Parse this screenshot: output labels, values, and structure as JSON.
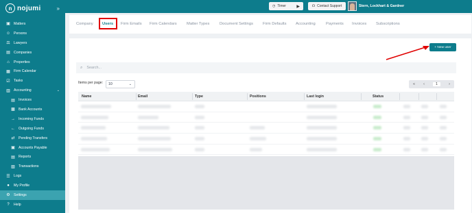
{
  "app": {
    "logo_text": "nojumi",
    "logo_mark": "n"
  },
  "sidebar": {
    "items": [
      {
        "label": "Matters",
        "icon": "briefcase-icon",
        "glyph": "▣"
      },
      {
        "label": "Persons",
        "icon": "persons-icon",
        "glyph": "☺"
      },
      {
        "label": "Lawyers",
        "icon": "lawyer-icon",
        "glyph": "⚖"
      },
      {
        "label": "Companies",
        "icon": "building-icon",
        "glyph": "▤"
      },
      {
        "label": "Properties",
        "icon": "home-icon",
        "glyph": "⌂"
      },
      {
        "label": "Firm Calendar",
        "icon": "calendar-icon",
        "glyph": "▦"
      },
      {
        "label": "Tasks",
        "icon": "tasks-icon",
        "glyph": "☑"
      },
      {
        "label": "Accounting",
        "icon": "wallet-icon",
        "glyph": "▥"
      },
      {
        "label": "Invoices",
        "icon": "invoice-icon",
        "glyph": "▤"
      },
      {
        "label": "Bank Accounts",
        "icon": "bank-icon",
        "glyph": "▩"
      },
      {
        "label": "Incoming Funds",
        "icon": "arrow-right-icon",
        "glyph": "→"
      },
      {
        "label": "Outgoing Funds",
        "icon": "arrow-left-icon",
        "glyph": "←"
      },
      {
        "label": "Pending Transfers",
        "icon": "transfer-icon",
        "glyph": "⇄"
      },
      {
        "label": "Accounts Payable",
        "icon": "payable-icon",
        "glyph": "▣"
      },
      {
        "label": "Reports",
        "icon": "report-icon",
        "glyph": "▤"
      },
      {
        "label": "Transactions",
        "icon": "transactions-icon",
        "glyph": "▧"
      },
      {
        "label": "Logs",
        "icon": "logs-icon",
        "glyph": "☰"
      },
      {
        "label": "My Profile",
        "icon": "profile-icon",
        "glyph": "●"
      },
      {
        "label": "Settings",
        "icon": "gear-icon",
        "glyph": "⚙"
      },
      {
        "label": "Help",
        "icon": "help-icon",
        "glyph": "?"
      }
    ]
  },
  "topbar": {
    "timer_label": "Timer",
    "support_label": "Contact Support",
    "user_name": "Stern, Lockhart & Gardner"
  },
  "tabs": [
    {
      "label": "Company"
    },
    {
      "label": "Users"
    },
    {
      "label": "Firm Emails"
    },
    {
      "label": "Firm Calendars"
    },
    {
      "label": "Matter Types"
    },
    {
      "label": "Document Settings"
    },
    {
      "label": "Firm Defaults"
    },
    {
      "label": "Accounting"
    },
    {
      "label": "Payments"
    },
    {
      "label": "Invoices"
    },
    {
      "label": "Subscriptions"
    }
  ],
  "users": {
    "new_user_label": "+ New user",
    "search_placeholder": "Search...",
    "items_per_page_label": "Items per page:",
    "items_per_page_value": "10",
    "pager": {
      "first": "«",
      "prev": "‹",
      "page": "1",
      "next": "›"
    },
    "columns": [
      "Name",
      "Email",
      "Type",
      "Positions",
      "Last login",
      "Status"
    ]
  },
  "colors": {
    "brand": "#0d7c8c",
    "highlight": "#e00000"
  }
}
